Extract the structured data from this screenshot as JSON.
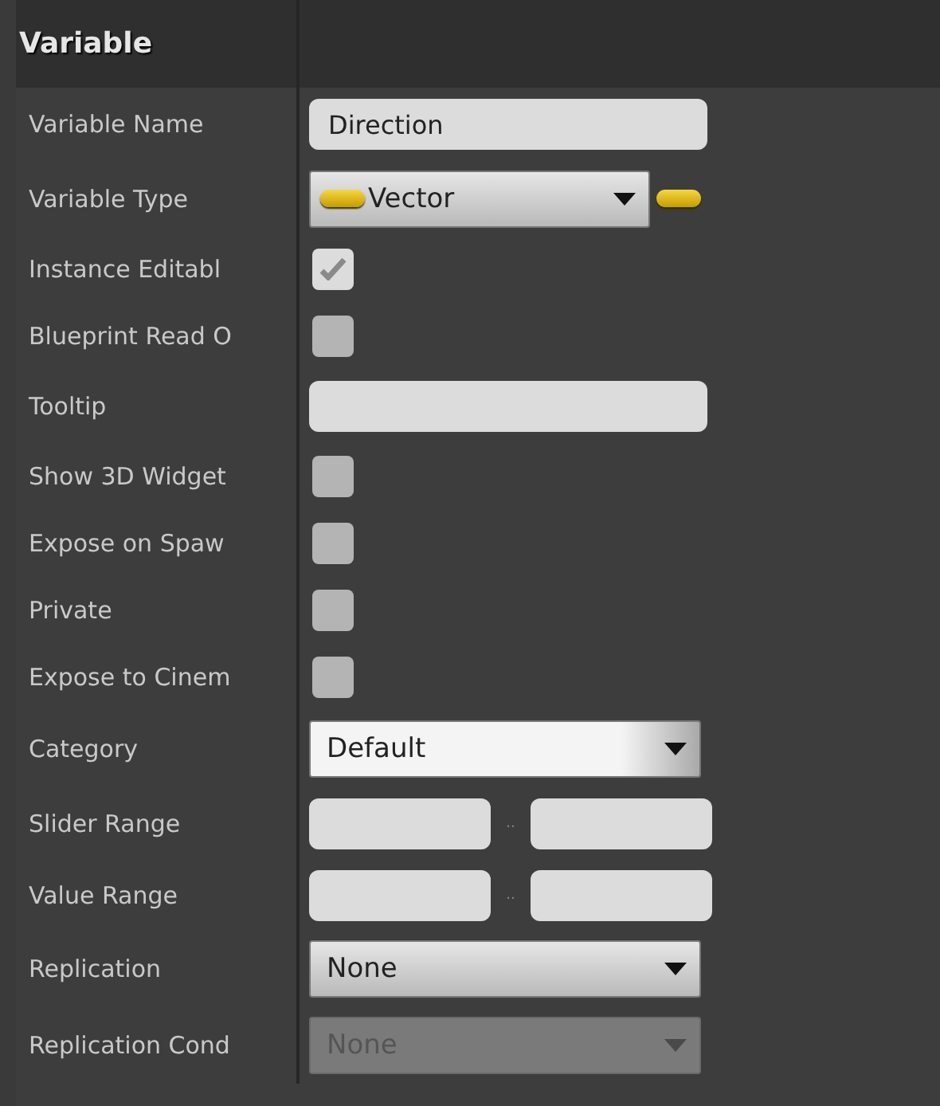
{
  "section": {
    "title": "Variable"
  },
  "rows": [
    {
      "label": "Variable Name",
      "kind": "text",
      "value": "Direction"
    },
    {
      "label": "Variable Type",
      "kind": "type",
      "value": "Vector"
    },
    {
      "label": "Instance Editabl",
      "kind": "checkbox",
      "checked": true
    },
    {
      "label": "Blueprint Read O",
      "kind": "checkbox",
      "checked": false
    },
    {
      "label": "Tooltip",
      "kind": "text"
    },
    {
      "label": "Show 3D Widget",
      "kind": "checkbox",
      "checked": false
    },
    {
      "label": "Expose on Spaw",
      "kind": "checkbox",
      "checked": false
    },
    {
      "label": "Private",
      "kind": "checkbox",
      "checked": false
    },
    {
      "label": "Expose to Cinem",
      "kind": "checkbox",
      "checked": false
    },
    {
      "label": "Category",
      "kind": "combo",
      "value": "Default",
      "disabled": false
    },
    {
      "label": "Slider Range",
      "kind": "range",
      "separator": ".."
    },
    {
      "label": "Value Range",
      "kind": "range",
      "separator": ".."
    },
    {
      "label": "Replication",
      "kind": "dropdown",
      "value": "None",
      "disabled": false
    },
    {
      "label": "Replication Cond",
      "kind": "dropdown",
      "value": "None",
      "disabled": true
    }
  ]
}
